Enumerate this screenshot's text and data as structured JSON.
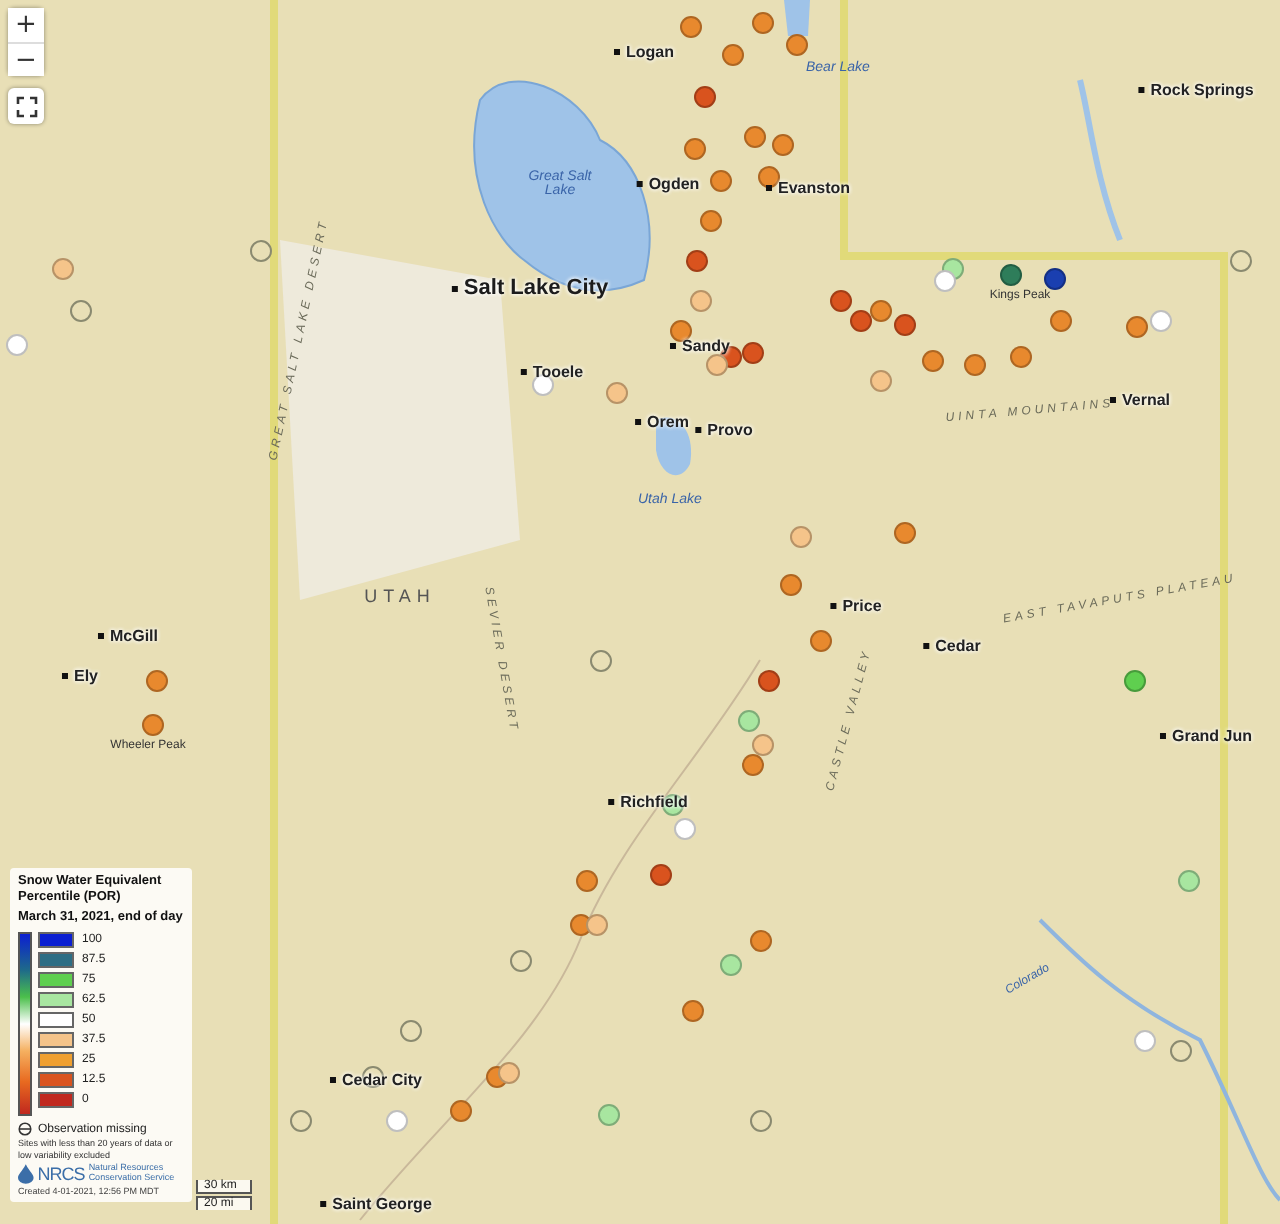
{
  "map_controls": {
    "zoom": [
      "+",
      "−"
    ]
  },
  "places": [
    {
      "name": "Logan",
      "kind": "city"
    },
    {
      "name": "Bear Lake",
      "kind": "water"
    },
    {
      "name": "Great Salt Lake",
      "kind": "water"
    },
    {
      "name": "Ogden",
      "kind": "city"
    },
    {
      "name": "Evanston",
      "kind": "city"
    },
    {
      "name": "Salt Lake City",
      "kind": "major"
    },
    {
      "name": "Tooele",
      "kind": "city"
    },
    {
      "name": "Sandy",
      "kind": "city"
    },
    {
      "name": "Orem",
      "kind": "city"
    },
    {
      "name": "Provo",
      "kind": "city"
    },
    {
      "name": "Utah Lake",
      "kind": "water"
    },
    {
      "name": "Kings Peak",
      "kind": "peak"
    },
    {
      "name": "Vernal",
      "kind": "city"
    },
    {
      "name": "Price",
      "kind": "city"
    },
    {
      "name": "Cedar",
      "kind": "city"
    },
    {
      "name": "Richfield",
      "kind": "city"
    },
    {
      "name": "Cedar City",
      "kind": "city"
    },
    {
      "name": "Saint George",
      "kind": "city"
    },
    {
      "name": "McGill",
      "kind": "city"
    },
    {
      "name": "Ely",
      "kind": "city"
    },
    {
      "name": "Wheeler Peak",
      "kind": "peak"
    },
    {
      "name": "Rock Springs",
      "kind": "city"
    },
    {
      "name": "Grand Jun",
      "kind": "city"
    },
    {
      "name": "UTAH",
      "kind": "region"
    },
    {
      "name": "GREAT SALT LAKE DESERT",
      "kind": "range"
    },
    {
      "name": "UINTA MOUNTAINS",
      "kind": "range"
    },
    {
      "name": "SEVIER DESERT",
      "kind": "range"
    },
    {
      "name": "CASTLE VALLEY",
      "kind": "range"
    },
    {
      "name": "EAST TAVAPUTS PLATEAU",
      "kind": "range"
    },
    {
      "name": "Colorado",
      "kind": "river"
    }
  ],
  "stations": [
    {
      "kind": "site",
      "color": "#e8892e"
    },
    {
      "kind": "site",
      "color": "#e8892e"
    },
    {
      "kind": "site",
      "color": "#e8892e"
    },
    {
      "kind": "site",
      "color": "#e8892e"
    },
    {
      "kind": "site",
      "color": "#d9531e"
    },
    {
      "kind": "site",
      "color": "#e8892e"
    },
    {
      "kind": "site",
      "color": "#e8892e"
    },
    {
      "kind": "site",
      "color": "#e8892e"
    },
    {
      "kind": "site",
      "color": "#e8892e"
    },
    {
      "kind": "site",
      "color": "#e8892e"
    },
    {
      "kind": "site",
      "color": "#e8892e"
    },
    {
      "kind": "site",
      "color": "#d9531e"
    },
    {
      "kind": "site",
      "color": "#f5c48a"
    },
    {
      "kind": "site",
      "color": "#e8892e"
    },
    {
      "kind": "site",
      "color": "#d9531e"
    },
    {
      "kind": "site",
      "color": "#d9531e"
    },
    {
      "kind": "site",
      "color": "#f5c48a"
    },
    {
      "kind": "site",
      "color": "#d9531e"
    },
    {
      "kind": "site",
      "color": "#d9531e"
    },
    {
      "kind": "site",
      "color": "#e8892e"
    },
    {
      "kind": "site",
      "color": "#d9531e"
    },
    {
      "kind": "site",
      "color": "#a8e6a0"
    },
    {
      "kind": "site",
      "color": "#ffffff"
    },
    {
      "kind": "site",
      "color": "#2e7d5a"
    },
    {
      "kind": "site",
      "color": "#1a3fb0"
    },
    {
      "kind": "site",
      "color": "#e8892e"
    },
    {
      "kind": "site",
      "color": "#e8892e"
    },
    {
      "kind": "site",
      "color": "#e8892e"
    },
    {
      "kind": "site",
      "color": "#e8892e"
    },
    {
      "kind": "site",
      "color": "#e8892e"
    },
    {
      "kind": "site",
      "color": "#f5c48a"
    },
    {
      "kind": "site",
      "color": "#ffffff"
    },
    {
      "kind": "site",
      "color": "#f5c48a"
    },
    {
      "kind": "site",
      "color": "#ffffff"
    },
    {
      "kind": "site",
      "color": "#f5c48a"
    },
    {
      "kind": "site",
      "color": "#e8892e"
    },
    {
      "kind": "site",
      "color": "#e8892e"
    },
    {
      "kind": "site",
      "color": "#e8892e"
    },
    {
      "kind": "site",
      "color": "#d9531e"
    },
    {
      "kind": "site",
      "color": "#a8e6a0"
    },
    {
      "kind": "site",
      "color": "#f5c48a"
    },
    {
      "kind": "site",
      "color": "#e8892e"
    },
    {
      "kind": "site",
      "color": "#a8e6a0"
    },
    {
      "kind": "site",
      "color": "#ffffff"
    },
    {
      "kind": "site",
      "color": "#d9531e"
    },
    {
      "kind": "site",
      "color": "#e8892e"
    },
    {
      "kind": "site",
      "color": "#e8892e"
    },
    {
      "kind": "site",
      "color": "#f5c48a"
    },
    {
      "kind": "site",
      "color": "#e8892e"
    },
    {
      "kind": "site",
      "color": "#e8892e"
    },
    {
      "kind": "site",
      "color": "#a8e6a0"
    },
    {
      "kind": "site",
      "color": "#5fcf4f"
    },
    {
      "kind": "site",
      "color": "#a8e6a0"
    },
    {
      "kind": "site",
      "color": "#e8892e"
    },
    {
      "kind": "site",
      "color": "#e8892e"
    },
    {
      "kind": "site",
      "color": "#f5c48a"
    },
    {
      "kind": "site",
      "color": "#ffffff"
    },
    {
      "kind": "site",
      "color": "#a8e6a0"
    },
    {
      "kind": "site",
      "color": "#e8892e"
    },
    {
      "kind": "site",
      "color": "#e8892e"
    },
    {
      "kind": "site",
      "color": "#ffffff"
    },
    {
      "kind": "site",
      "color": "#f5c48a"
    },
    {
      "kind": "site",
      "color": "#ffffff"
    },
    {
      "kind": "missing"
    },
    {
      "kind": "missing"
    },
    {
      "kind": "missing"
    },
    {
      "kind": "missing"
    },
    {
      "kind": "missing"
    },
    {
      "kind": "missing"
    },
    {
      "kind": "missing"
    },
    {
      "kind": "missing"
    },
    {
      "kind": "missing"
    },
    {
      "kind": "missing"
    }
  ],
  "legend": {
    "title": "Snow Water Equivalent Percentile (POR)",
    "subtitle": "March 31, 2021, end of day",
    "classes": [
      {
        "label": "100",
        "color": "#0b1fd1"
      },
      {
        "label": "87.5",
        "color": "#2e6e84"
      },
      {
        "label": "75",
        "color": "#5fcf4f"
      },
      {
        "label": "62.5",
        "color": "#a8e6a0"
      },
      {
        "label": "50",
        "color": "#ffffff"
      },
      {
        "label": "37.5",
        "color": "#f5c48a"
      },
      {
        "label": "25",
        "color": "#f0a030"
      },
      {
        "label": "12.5",
        "color": "#d9531e"
      },
      {
        "label": "0",
        "color": "#c0281e"
      }
    ],
    "missing_label": "Observation missing",
    "note": "Sites with less than 20 years of data or low variability excluded",
    "logo_text": "NRCS",
    "agency": "Natural Resources Conservation Service",
    "created": "Created 4-01-2021, 12:56 PM MDT"
  },
  "scale": [
    "30 km",
    "20 mi"
  ]
}
